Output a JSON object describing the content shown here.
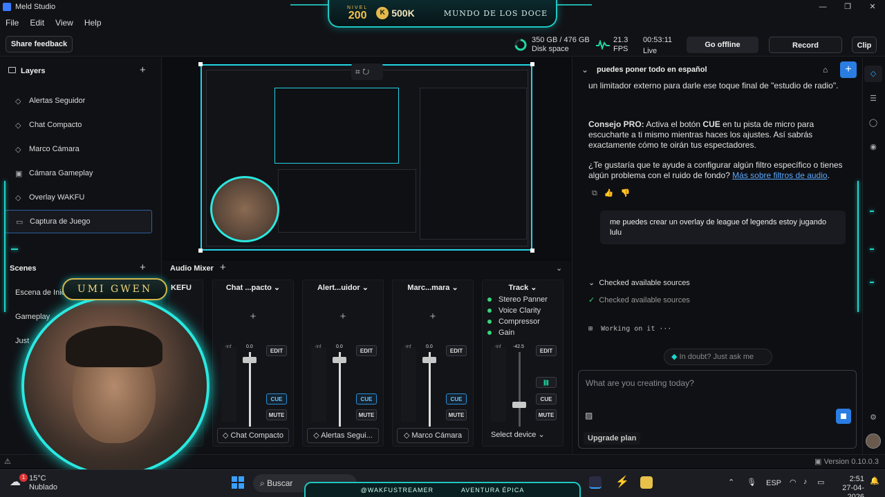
{
  "window": {
    "title": "Meld Studio",
    "minimize": "—",
    "maximize": "❐",
    "close": "✕"
  },
  "menu": [
    "File",
    "Edit",
    "View",
    "Help"
  ],
  "banner": {
    "nivel_label": "NIVEL",
    "nivel_value": "200",
    "coin": "K",
    "coin_value": "500K",
    "world": "MUNDO DE LOS DOCE"
  },
  "toolbar": {
    "share_feedback": "Share feedback",
    "disk": "350 GB / 476 GB",
    "disk_label": "Disk space",
    "fps": "21.3",
    "fps_label": "FPS",
    "live_time": "00:53:11",
    "live_label": "Live",
    "go_offline": "Go offline",
    "record": "Record",
    "clip": "Clip"
  },
  "layers": {
    "title": "Layers",
    "items": [
      {
        "label": "Alertas Seguidor",
        "icon": "diamond-icon"
      },
      {
        "label": "Chat Compacto",
        "icon": "diamond-icon"
      },
      {
        "label": "Marco Cámara",
        "icon": "diamond-icon"
      },
      {
        "label": "Cámara Gameplay",
        "icon": "camera-icon"
      },
      {
        "label": "Overlay WAKFU",
        "icon": "diamond-icon"
      },
      {
        "label": "Captura de Juego",
        "icon": "monitor-icon",
        "selected": true
      }
    ]
  },
  "scenes": {
    "title": "Scenes",
    "items": [
      "Escena de Inic",
      "Gameplay",
      "Just"
    ]
  },
  "mixer": {
    "title": "Audio Mixer",
    "partial_channel": "KEFU",
    "channels": [
      {
        "name": "Chat ...pacto",
        "level": "0.0",
        "inf": "-inf",
        "device": "Chat Compacto",
        "fader_pct": 0.9
      },
      {
        "name": "Alert...uidor",
        "level": "0.0",
        "inf": "-inf",
        "device": "Alertas Segui...",
        "fader_pct": 0.9
      },
      {
        "name": "Marc...mara",
        "level": "0.0",
        "inf": "-inf",
        "device": "Marco Cámara",
        "fader_pct": 0.9
      }
    ],
    "track": {
      "name": "Track",
      "level": "-42.5",
      "inf": "-inf",
      "device": "Select device",
      "fader_pct": 0.3,
      "filters": [
        "Stereo Panner",
        "Voice Clarity",
        "Compressor",
        "Gain"
      ]
    },
    "edit": "EDIT",
    "cue": "CUE",
    "mute": "MUTE"
  },
  "chat": {
    "header": "puedes poner todo en español",
    "line0": "un limitador externo para darle ese toque final de \"estudio de radio\".",
    "tip_prefix": "Consejo PRO:",
    "tip_mid1": " Activa el botón ",
    "tip_cue": "CUE",
    "tip_rest": " en tu pista de micro para escucharte a ti mismo mientras haces los ajustes. Así sabrás exactamente cómo te oirán tus espectadores.",
    "question": "¿Te gustaría que te ayude a configurar algún filtro específico o tienes algún problema con el ruido de fondo? ",
    "link": "Más sobre filtros de audio",
    "link_end": ".",
    "user_msg": "me puedes crear un overlay de league of legends estoy jugando lulu",
    "checked_head": "Checked available sources",
    "checked_item": "Checked available sources",
    "working": "Working on it ···",
    "doubt": "In doubt? Just ask me",
    "placeholder": "What are you creating today?",
    "upgrade": "Upgrade plan"
  },
  "overlay": {
    "name_tag": "UMI GWEN",
    "stream_handle": "@WAKFUSTREAMER",
    "stream_tag": "AVENTURA ÉPICA"
  },
  "statusbar": {
    "version": "Version 0.10.0.3"
  },
  "taskbar": {
    "weather_badge": "1",
    "temp": "15°C",
    "weather": "Nublado",
    "search": "Buscar",
    "lang": "ESP",
    "time": "2:51",
    "date": "27-04-2026"
  },
  "colors": {
    "accent": "#1fd6cc",
    "blue": "#2a7de1",
    "gold": "#f2c14e"
  }
}
